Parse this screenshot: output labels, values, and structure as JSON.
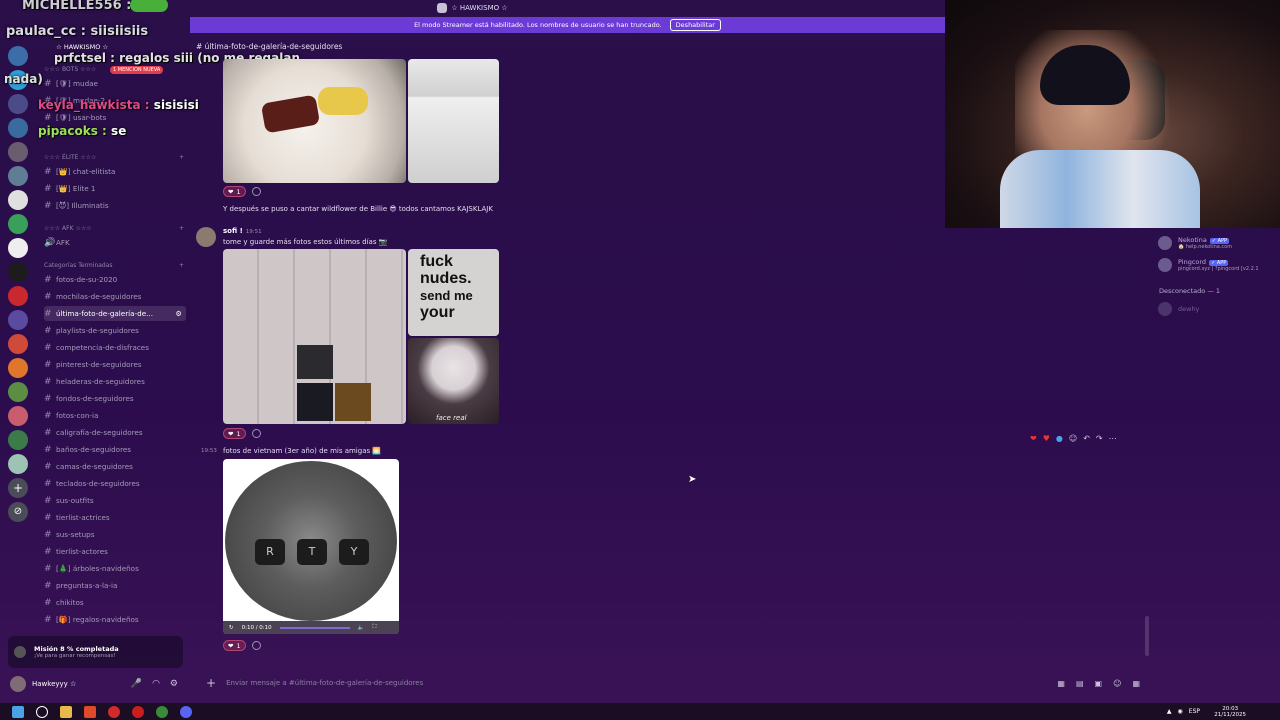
{
  "window": {
    "server_title": "☆ HAWKISMO ☆"
  },
  "banner": {
    "text": "El modo Streamer está habilitado. Los nombres de usuario se han truncado.",
    "button": "Deshabilitar"
  },
  "overlay_chat": [
    {
      "user": "MICHELLE556 :",
      "text": ""
    },
    {
      "user": "paulac_cc :",
      "text": "siisiisiis"
    },
    {
      "user": "prfctsel :",
      "text": "regalos siii (no me regalan"
    },
    {
      "user": "",
      "text": "nada)"
    },
    {
      "user": "keyla_hawkista :",
      "text": "sisisisi"
    },
    {
      "user": "pipacoks :",
      "text": "se"
    }
  ],
  "sidebar": {
    "server_name": "☆ HAWKISMO ☆",
    "mention_badge": "1 MENCIÓN NUEVA",
    "categories": {
      "bots": "☆☆☆ BOTS ☆☆☆",
      "elite": "☆☆☆ ÉLITE ☆☆☆",
      "afk": "☆☆☆ AFK ☆☆☆",
      "terminadas": "Categorías Terminadas"
    },
    "channels_bots": [
      "[🛡] mudae",
      "[🛡] mudae-2",
      "[🛡] usar-bots",
      "☆☆☆☆"
    ],
    "channels_elite": [
      "[👑] chat-elitista",
      "[👑] Elite 1",
      "[😈] Illuminatis"
    ],
    "channels_afk": [
      "AFK"
    ],
    "channels_terminadas": [
      "fotos-de-su-2020",
      "mochilas-de-seguidores",
      "última-foto-de-galería-de...",
      "playlists-de-seguidores",
      "competencia-de-disfraces",
      "pinterest-de-seguidores",
      "heladeras-de-seguidores",
      "fondos-de-seguidores",
      "fotos-con-ia",
      "caligrafía-de-seguidores",
      "baños-de-seguidores",
      "camas-de-seguidores",
      "teclados-de-seguidores",
      "sus-outfits",
      "tierlist-actrices",
      "sus-setups",
      "tierlist-actores",
      "[🎄] árboles-navideños",
      "preguntas-a-la-ia",
      "chikitos",
      "[🎁] regalos-navideños"
    ]
  },
  "mission": {
    "title": "Misión 8 % completada",
    "subtitle": "¡Ve para ganar recompensas!"
  },
  "user": {
    "name": "Hawkeyyy ☆"
  },
  "chat": {
    "channel": "última-foto-de-galería-de-seguidores",
    "messages": [
      {
        "text": "Y después se puso a cantar wildflower de Billie 😎 todos cantamos KAJSKLAJK"
      },
      {
        "author": "sofi !",
        "time": "19:51",
        "text": "tome y guarde más fotos estos últimos días 📷"
      },
      {
        "time": "19:53",
        "text": "fotos de vietnam (3er año) de mis amigas 🌅"
      }
    ],
    "reaction_count": "1",
    "meme_text": [
      "fuck",
      "nudes.",
      "send me",
      "your"
    ],
    "doll_caption": "face real",
    "keyboard_keys": [
      "R",
      "T",
      "Y"
    ],
    "video_time": "0:10 / 0:10",
    "input_placeholder": "Enviar mensaje a #última-foto-de-galería-de-seguidores"
  },
  "members": [
    {
      "name": "Nekotina",
      "badge": "✓ APP",
      "sub": "🏠 help.nekotina.com"
    },
    {
      "name": "Pingcord",
      "badge": "✓ APP",
      "sub": "pingcord.xyz | ?pingcord [v2.2.1"
    }
  ],
  "offline_header": "Desconectado — 1",
  "offline_member": "dewhy",
  "taskbar": {
    "time": "20:03",
    "date": "21/11/2025",
    "lang": "ESP"
  },
  "colors": {
    "accent": "#6c3bd6",
    "bg": "#2a0f49",
    "reaction": "#b14671"
  }
}
